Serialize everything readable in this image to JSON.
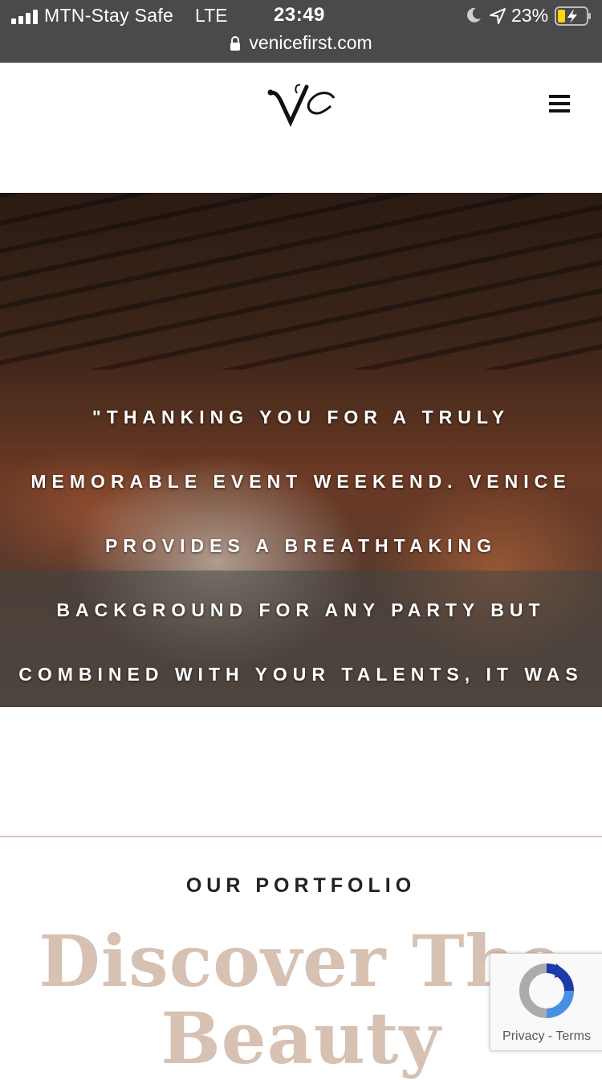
{
  "status_bar": {
    "carrier": "MTN-Stay Safe",
    "network": "LTE",
    "time": "23:49",
    "battery_percent": "23%",
    "url": "venicefirst.com"
  },
  "header": {
    "logo_icon": "vf-monogram-logo",
    "menu_icon": "hamburger-menu-icon"
  },
  "hero": {
    "quote_lines": [
      "\"THANKING YOU FOR A TRULY",
      "MEMORABLE EVENT WEEKEND. VENICE",
      "PROVIDES A BREATHTAKING",
      "BACKGROUND FOR ANY PARTY BUT",
      "COMBINED WITH YOUR TALENTS, IT WAS"
    ]
  },
  "portfolio": {
    "label": "OUR PORTFOLIO",
    "headline_line1": "Discover The",
    "headline_line2": "Beauty"
  },
  "recaptcha": {
    "privacy": "Privacy",
    "separator": "-",
    "terms": "Terms"
  },
  "colors": {
    "status_bar_bg": "#4a4a4a",
    "headline": "#d6c1b3",
    "divider": "#d9c4b8",
    "battery_fill": "#ffd60a"
  }
}
